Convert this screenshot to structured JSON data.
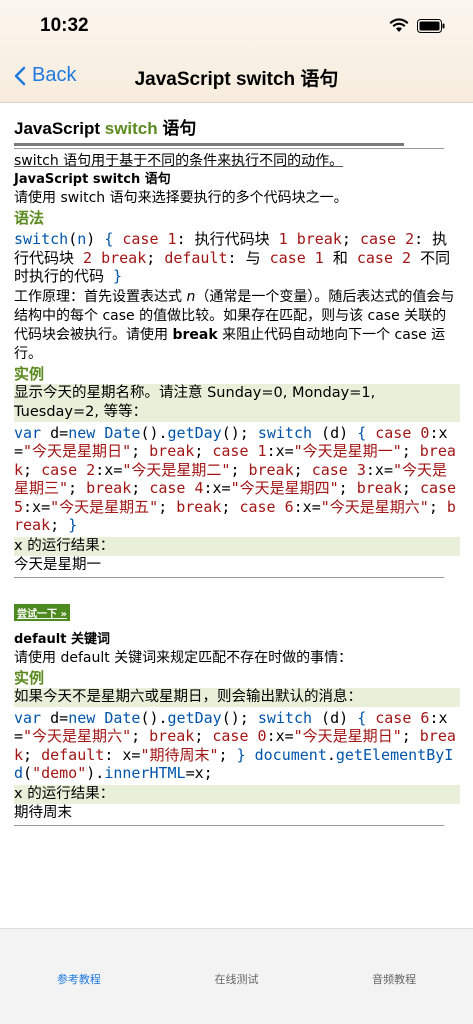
{
  "status": {
    "time": "10:32"
  },
  "nav": {
    "back_label": "Back",
    "title": "JavaScript switch 语句"
  },
  "page": {
    "heading_prefix": "JavaScript ",
    "heading_highlight": "switch",
    "heading_suffix": " 语句",
    "intro": "switch 语句用于基于不同的条件来执行不同的动作。",
    "section1_title": "JavaScript switch 语句",
    "section1_desc": "请使用 switch 语句来选择要执行的多个代码块之一。",
    "syntax_label": "语法",
    "how_it_works_a": "工作原理：首先设置表达式 ",
    "how_it_works_n": "n",
    "how_it_works_b": "（通常是一个变量）。随后表达式的值会与结构中的每个 case 的值做比较。如果存在匹配，则与该 case 关联的代码块会被执行。请使用 ",
    "how_it_works_break": "break",
    "how_it_works_c": " 来阻止代码自动地向下一个 case 运行。",
    "example_label": "实例",
    "example1_desc": "显示今天的星期名称。请注意 Sunday=0, Monday=1, Tuesday=2, 等等：",
    "result_label": "x 的运行结果：",
    "example1_result": "今天是星期一",
    "try_label": "尝试一下 »",
    "section2_title": "default 关键词",
    "section2_desc": "请使用 default 关键词来规定匹配不存在时做的事情：",
    "example2_label": "实例",
    "example2_desc": "如果今天不是星期六或星期日，则会输出默认的消息：",
    "result2_label": "x 的运行结果：",
    "example2_result": "期待周末"
  },
  "code": {
    "syntax": [
      "switch",
      "(",
      "n",
      ")",
      " { ",
      "case",
      " ",
      "1",
      ": 执行代码块 ",
      "1",
      " ",
      "break",
      "; ",
      "case",
      " ",
      "2",
      ": 执行代码块 ",
      "2",
      " ",
      "break",
      "; ",
      "default",
      ": 与 ",
      "case",
      " ",
      "1",
      " 和 ",
      "case",
      " ",
      "2",
      " 不同时执行的代码 }"
    ],
    "ex1_day1": "\"今天是星期日\"",
    "ex1_day2": "\"今天是星期一\"",
    "ex1_day3": "\"今天是星期二\"",
    "ex1_day4": "\"今天是星期三\"",
    "ex1_day5": "\"今天是星期四\"",
    "ex1_day6": "\"今天是星期五\"",
    "ex1_day7": "\"今天是星期六\"",
    "ex2_sat": "\"今天是星期六\"",
    "ex2_sun": "\"今天是星期日\"",
    "ex2_def": "\"期待周末\"",
    "ex2_demo": "\"demo\""
  },
  "tabs": [
    {
      "label": "参考教程",
      "active": true
    },
    {
      "label": "在线测试",
      "active": false
    },
    {
      "label": "音频教程",
      "active": false
    }
  ],
  "colors": {
    "accent": "#1f7ae0",
    "green": "#5b8a1e"
  }
}
